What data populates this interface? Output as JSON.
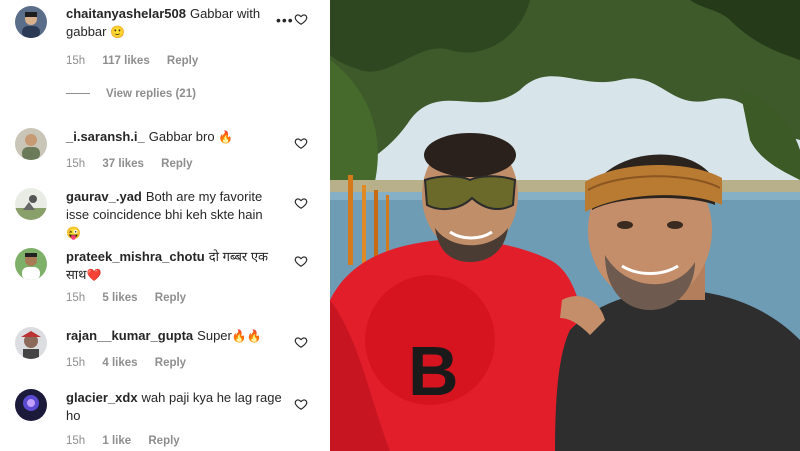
{
  "comments": [
    {
      "username": "chaitanyashelar508",
      "text": "Gabbar with gabbar",
      "emoji": "🙂",
      "time": "15h",
      "likes": "117 likes",
      "reply": "Reply"
    },
    {
      "username": "_i.saransh.i_",
      "text": "Gabbar bro",
      "emoji": "🔥",
      "time": "15h",
      "likes": "37 likes",
      "reply": "Reply"
    },
    {
      "username": "gaurav_.yad",
      "text": "Both are my favorite isse coincidence bhi keh skte hain",
      "emoji": "😜",
      "time": "",
      "likes": "",
      "reply": ""
    },
    {
      "username": "prateek_mishra_chotu",
      "text": "दो गब्बर एक साथ",
      "emoji": "❤️",
      "time": "15h",
      "likes": "5 likes",
      "reply": "Reply"
    },
    {
      "username": "rajan__kumar_gupta",
      "text": "Super",
      "emoji": "🔥🔥",
      "time": "15h",
      "likes": "4 likes",
      "reply": "Reply"
    },
    {
      "username": "glacier_xdx",
      "text": "wah paji kya he lag rage ho",
      "emoji": "",
      "time": "15h",
      "likes": "1 like",
      "reply": "Reply"
    }
  ],
  "view_replies": "View replies (21)",
  "more_icon": "•••",
  "colors": {
    "text": "#262626",
    "muted": "#8e8e8e",
    "shirt_red": "#e8232f",
    "sky": "#d8e6ec",
    "water": "#6f9fb8"
  }
}
